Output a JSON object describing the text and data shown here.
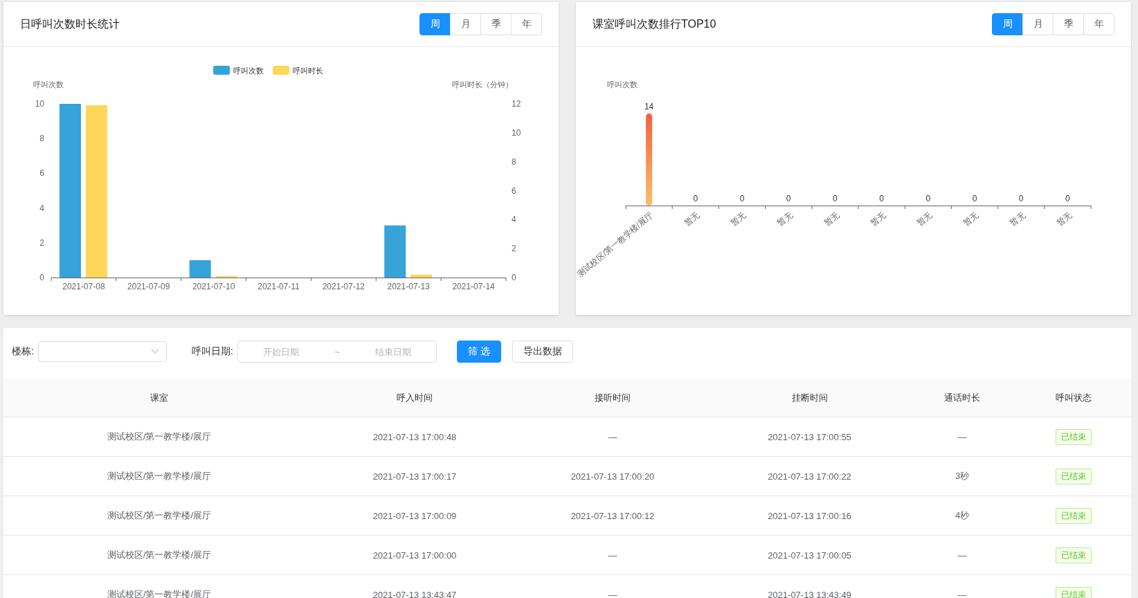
{
  "daily_panel": {
    "title": "日呼叫次数时长统计",
    "periods": [
      {
        "label": "周",
        "selected": true
      },
      {
        "label": "月",
        "selected": false
      },
      {
        "label": "季",
        "selected": false
      },
      {
        "label": "年",
        "selected": false
      }
    ],
    "chart_data": {
      "type": "bar",
      "ylabel": "呼叫次数",
      "categories": [
        "2021-07-08",
        "2021-07-09",
        "2021-07-10",
        "2021-07-11",
        "2021-07-12",
        "2021-07-13",
        "2021-07-14"
      ],
      "ylim": [
        0,
        10
      ],
      "yticks": [
        0,
        2,
        4,
        6,
        8,
        10
      ],
      "series": [
        {
          "name": "呼叫次数",
          "color": "#36a3d9",
          "values": [
            10,
            0,
            1,
            0,
            0,
            3,
            0
          ]
        }
      ]
    },
    "duration_axis": {
      "chart_data": {
        "type": "bar",
        "ylabel": "呼叫时长（分钟）",
        "ylim": [
          0,
          12
        ],
        "yticks": [
          0,
          2,
          4,
          6,
          8,
          10,
          12
        ],
        "series": [
          {
            "name": "呼叫时长",
            "color": "#fed75a",
            "values": [
              11.9,
              0,
              0.1,
              0,
              0,
              0.2,
              0
            ]
          }
        ]
      }
    }
  },
  "rank_panel": {
    "title": "课室呼叫次数排行TOP10",
    "periods": [
      {
        "label": "周",
        "selected": true
      },
      {
        "label": "月",
        "selected": false
      },
      {
        "label": "季",
        "selected": false
      },
      {
        "label": "年",
        "selected": false
      }
    ],
    "chart_data": {
      "type": "bar",
      "ylabel": "呼叫次数",
      "data_labels": true,
      "categories": [
        "测试校区/第一教学楼/展厅",
        "暂无",
        "暂无",
        "暂无",
        "暂无",
        "暂无",
        "暂无",
        "暂无",
        "暂无",
        "暂无"
      ],
      "series": [
        {
          "color": "#f5603a",
          "values": [
            14,
            0,
            0,
            0,
            0,
            0,
            0,
            0,
            0,
            0
          ]
        }
      ]
    }
  },
  "filters": {
    "building_label": "楼栋:",
    "date_label": "呼叫日期:",
    "start_placeholder": "开始日期",
    "separator": "~",
    "end_placeholder": "结束日期",
    "filter_button": "筛 选",
    "export_button": "导出数据"
  },
  "table": {
    "columns": [
      "课室",
      "呼入时间",
      "接听时间",
      "挂断时间",
      "通话时长",
      "呼叫状态"
    ],
    "rows": [
      [
        "测试校区/第一教学楼/展厅",
        "2021-07-13 17:00:48",
        "—",
        "2021-07-13 17:00:55",
        "—",
        "已结束"
      ],
      [
        "测试校区/第一教学楼/展厅",
        "2021-07-13 17:00:17",
        "2021-07-13 17:00:20",
        "2021-07-13 17:00:22",
        "3秒",
        "已结束"
      ],
      [
        "测试校区/第一教学楼/展厅",
        "2021-07-13 17:00:09",
        "2021-07-13 17:00:12",
        "2021-07-13 17:00:16",
        "4秒",
        "已结束"
      ],
      [
        "测试校区/第一教学楼/展厅",
        "2021-07-13 17:00:00",
        "—",
        "2021-07-13 17:00:05",
        "—",
        "已结束"
      ],
      [
        "测试校区/第一教学楼/展厅",
        "2021-07-13 13:43:47",
        "—",
        "2021-07-13 13:43:49",
        "—",
        "已结束"
      ]
    ]
  }
}
